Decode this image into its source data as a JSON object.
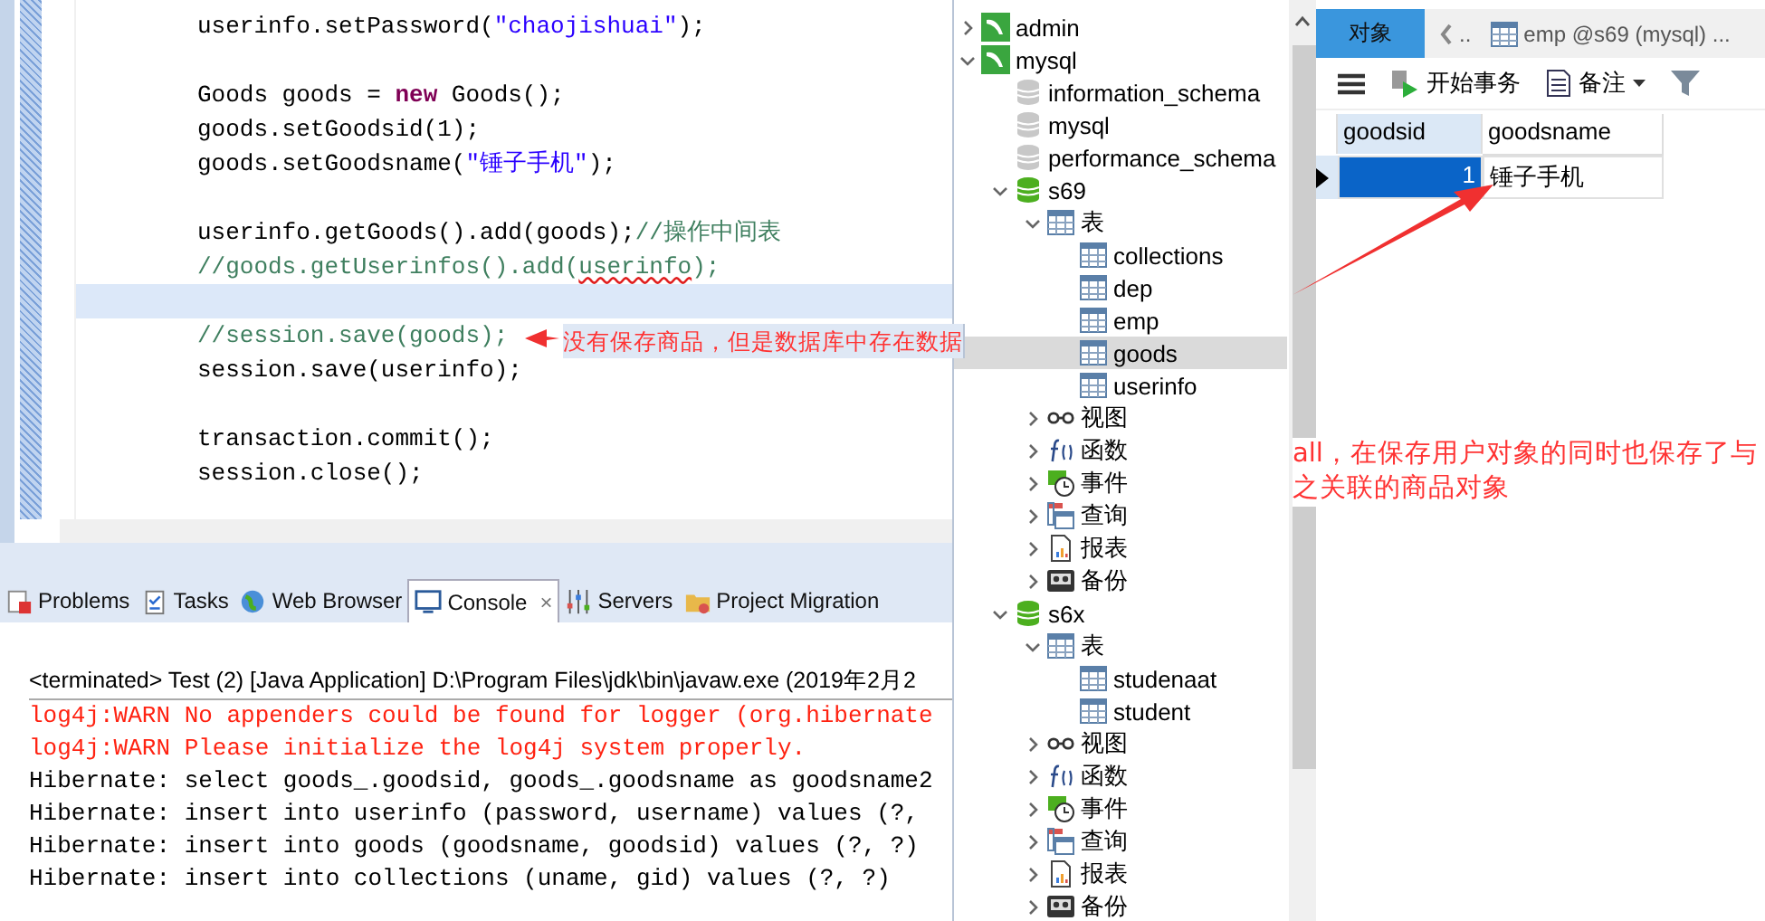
{
  "editor": {
    "lines": [
      {
        "current": false,
        "segments": [
          {
            "kind": "text",
            "text": "userinfo.setPassword("
          },
          {
            "kind": "string",
            "text": "\"chaojishuai\""
          },
          {
            "kind": "text",
            "text": ");"
          }
        ]
      },
      {
        "current": false
      },
      {
        "current": false,
        "segments": [
          {
            "kind": "text",
            "text": "Goods goods = "
          },
          {
            "kind": "keyword",
            "text": "new"
          },
          {
            "kind": "text",
            "text": " Goods();"
          }
        ]
      },
      {
        "current": false,
        "segments": [
          {
            "kind": "text",
            "text": "goods.setGoodsid(1);"
          }
        ]
      },
      {
        "current": false,
        "segments": [
          {
            "kind": "text",
            "text": "goods.setGoodsname("
          },
          {
            "kind": "string",
            "text": "\"锤子手机\""
          },
          {
            "kind": "text",
            "text": ");"
          }
        ]
      },
      {
        "current": false
      },
      {
        "current": false,
        "segments": [
          {
            "kind": "text",
            "text": "userinfo.getGoods().add(goods);"
          },
          {
            "kind": "comment",
            "text": "//操作中间表"
          }
        ]
      },
      {
        "current": false,
        "segments": [
          {
            "kind": "comment",
            "text": "//goods.getUserinfos().add("
          },
          {
            "kind": "comment-error",
            "text": "userinfo"
          },
          {
            "kind": "comment",
            "text": ");"
          }
        ]
      },
      {
        "current": true
      },
      {
        "current": false,
        "segments": [
          {
            "kind": "comment",
            "text": "//session.save(goods);"
          }
        ]
      },
      {
        "current": false,
        "segments": [
          {
            "kind": "text",
            "text": "session.save(userinfo);"
          }
        ]
      },
      {
        "current": false
      },
      {
        "current": false,
        "segments": [
          {
            "kind": "text",
            "text": "transaction.commit();"
          }
        ]
      },
      {
        "current": false,
        "segments": [
          {
            "kind": "text",
            "text": "session.close();"
          }
        ]
      }
    ]
  },
  "console_tabs": [
    {
      "label": "Problems",
      "kind": "problems",
      "selected": false
    },
    {
      "label": "Tasks",
      "kind": "tasks",
      "selected": false
    },
    {
      "label": "Web Browser",
      "kind": "browser",
      "selected": false
    },
    {
      "label": "Console",
      "kind": "console",
      "selected": true,
      "close": "×"
    },
    {
      "label": "Servers",
      "kind": "servers",
      "selected": false
    },
    {
      "label": "Project Migration",
      "kind": "migration",
      "selected": false
    }
  ],
  "console": {
    "header": "<terminated> Test (2) [Java Application] D:\\Program Files\\jdk\\bin\\javaw.exe (2019年2月2",
    "lines": [
      {
        "kind": "warn",
        "text": "log4j:WARN No appenders could be found for logger (org.hibernate"
      },
      {
        "kind": "warn",
        "text": "log4j:WARN Please initialize the log4j system properly."
      },
      {
        "kind": "info",
        "text": "Hibernate: select goods_.goodsid, goods_.goodsname as goodsname2"
      },
      {
        "kind": "info",
        "text": "Hibernate: insert into userinfo (password, username) values (?,"
      },
      {
        "kind": "info",
        "text": "Hibernate: insert into goods (goodsname, goodsid) values (?, ?)"
      },
      {
        "kind": "info",
        "text": "Hibernate: insert into collections (uname, gid) values (?, ?)"
      }
    ]
  },
  "tree": [
    {
      "label": "admin",
      "kind": "connection",
      "expanded": false,
      "selected": false
    },
    {
      "label": "mysql",
      "kind": "connection",
      "expanded": true,
      "selected": false,
      "children": [
        {
          "label": "information_schema",
          "kind": "database-closed",
          "selected": false
        },
        {
          "label": "mysql",
          "kind": "database-closed",
          "selected": false
        },
        {
          "label": "performance_schema",
          "kind": "database-closed",
          "selected": false
        },
        {
          "label": "s69",
          "kind": "database",
          "expanded": true,
          "selected": false,
          "children": [
            {
              "label": "表",
              "kind": "tables",
              "expanded": true,
              "selected": false,
              "children": [
                {
                  "label": "collections",
                  "kind": "table",
                  "selected": false
                },
                {
                  "label": "dep",
                  "kind": "table",
                  "selected": false
                },
                {
                  "label": "emp",
                  "kind": "table",
                  "selected": false
                },
                {
                  "label": "goods",
                  "kind": "table",
                  "selected": true
                },
                {
                  "label": "userinfo",
                  "kind": "table",
                  "selected": false
                }
              ]
            },
            {
              "label": "视图",
              "kind": "views",
              "expanded": false,
              "selected": false
            },
            {
              "label": "函数",
              "kind": "functions",
              "expanded": false,
              "selected": false
            },
            {
              "label": "事件",
              "kind": "events",
              "expanded": false,
              "selected": false
            },
            {
              "label": "查询",
              "kind": "queries",
              "expanded": false,
              "selected": false
            },
            {
              "label": "报表",
              "kind": "reports",
              "expanded": false,
              "selected": false
            },
            {
              "label": "备份",
              "kind": "backups",
              "expanded": false,
              "selected": false
            }
          ]
        },
        {
          "label": "s6x",
          "kind": "database",
          "expanded": true,
          "selected": false,
          "children": [
            {
              "label": "表",
              "kind": "tables",
              "expanded": true,
              "selected": false,
              "children": [
                {
                  "label": "studenaat",
                  "kind": "table",
                  "selected": false
                },
                {
                  "label": "student",
                  "kind": "table",
                  "selected": false
                }
              ]
            },
            {
              "label": "视图",
              "kind": "views",
              "expanded": false,
              "selected": false
            },
            {
              "label": "函数",
              "kind": "functions",
              "expanded": false,
              "selected": false
            },
            {
              "label": "事件",
              "kind": "events",
              "expanded": false,
              "selected": false
            },
            {
              "label": "查询",
              "kind": "queries",
              "expanded": false,
              "selected": false
            },
            {
              "label": "报表",
              "kind": "reports",
              "expanded": false,
              "selected": false
            },
            {
              "label": "备份",
              "kind": "backups",
              "expanded": false,
              "selected": false
            }
          ]
        }
      ]
    }
  ],
  "tabs": [
    {
      "label": "对象",
      "kind": "objects",
      "selected": true
    },
    {
      "label": "..",
      "kind": "back",
      "selected": false
    },
    {
      "label": "emp @s69 (mysql) ...",
      "kind": "table",
      "selected": false
    }
  ],
  "toolbar": [
    {
      "kind": "menu"
    },
    {
      "kind": "transaction",
      "label": "开始事务"
    },
    {
      "kind": "note",
      "label": "备注"
    },
    {
      "kind": "filter"
    }
  ],
  "grid": {
    "columns": [
      "goodsid",
      "goodsname"
    ],
    "rows": [
      {
        "selected": true,
        "cells": [
          "1",
          "锤子手机"
        ]
      }
    ]
  },
  "annotations": [
    {
      "kind": "left",
      "text": "没有保存商品，但是数据库中存在数据"
    },
    {
      "kind": "right",
      "text": "all，在保存用户对象的同时也保存了与之关联的商品对象"
    }
  ]
}
